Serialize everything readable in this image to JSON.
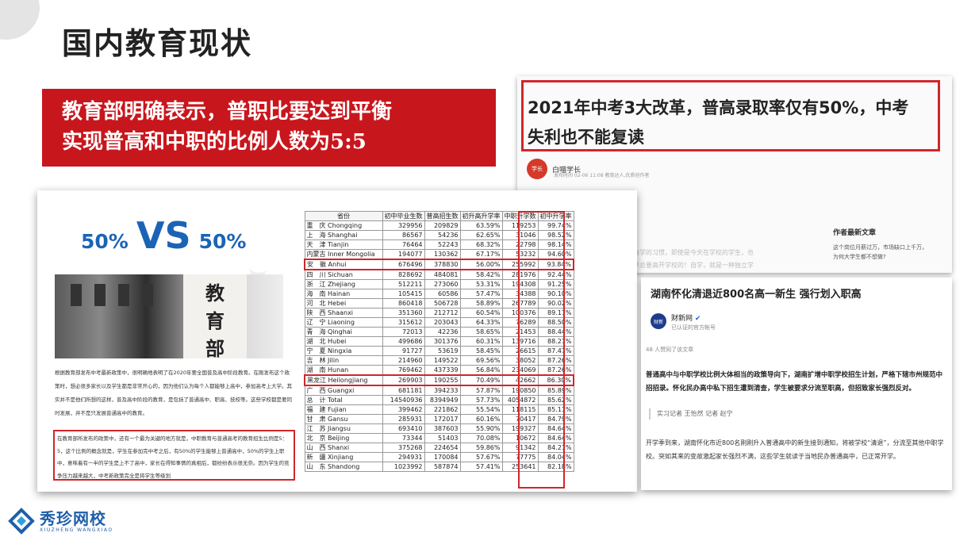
{
  "slide": {
    "title": "国内教育现状",
    "banner_line1": "教育部明确表示，普职比要达到平衡",
    "banner_line2": "实现普高和中职的比例人数为5:5",
    "accent_color": "#c8161d"
  },
  "article1": {
    "headline_line1": "2021年中考3大改革，普高录取率仅有50%，中考",
    "headline_line2": "失利也不能复读",
    "author": "白喵学长",
    "meta": "发布时间 02-06 11:08  教育达人,优质创作者",
    "body_line1": "成自学的习惯，即使是今天在学校的学生，也",
    "body_line2": "是早总要高开学校的！自学，就是一种独立学",
    "side_title": "作者最新文章",
    "side_text": "这个岗位月薪过万，市场缺口上千万，为何大学生都不想做?"
  },
  "article2": {
    "title": "湖南怀化清退近800名高一新生 强行划入职高",
    "source": "财新网",
    "verified": "已认证的官方帐号",
    "likes": "48 人赞同了该文章",
    "lead": "普通高中与中职学校比例大体相当的政策导向下，湖南扩增中职学校招生计划，严格下辖市州规范中招招录。怀化民办高中私下招生遭到清查，学生被要求分流至职高，但招致家长强烈反对。",
    "reporter": "实习记者 王怡然 记者 赵宁",
    "body": "开学季到来，湖南怀化市近800名刚刚升入普通高中的新生接到通知，将被学校“清退”，分流至其他中职学校。突如其来的变故激起家长强烈不满，这些学生就读于当地民办普通高中，已正常开学。"
  },
  "doc": {
    "vs_left": "50%",
    "vs_word": "VS",
    "vs_right": "50%",
    "plaque": [
      "教",
      "育",
      "部"
    ],
    "para1": "根据教育部发布中考最新政策中，很明确地表明了在2020年要全国普及高中阶段教育。在刚发布这个政策时，想必很多家长以及学生都是非常开心的，因为他们认为每个人都能够上高中，参加高考上大学。其实并不是他们所想的这样，普及高中阶段的教育，是包括了普通高中、职高、技校等。这些学校都是要同时发展，并不是只发展普通高中的教育。",
    "para2": "在教育部所发布的政策中，还有一个最为关键的地方就是，中职教育与普通高考的教育招生比例是5：5，这个比例的概念就是，学生在参加完中考之后，有50%的学生能够上普通高中，50%的学生上职中，意味着有一半的学生是上不了高中，家长在得知事情的真相后，都纷纷表示很无奈。因为学生的竞争压力越来越大，中考新政策完全是将学生等级划"
  },
  "table": {
    "headers": [
      "省份",
      "初中毕业生数",
      "普高招生数",
      "初升高升学率",
      "中职升学数",
      "初中升学率"
    ],
    "rows": [
      [
        "重　庆 Chongqing",
        "329956",
        "209829",
        "63.59%",
        "119253",
        "99.74%"
      ],
      [
        "上　海 Shanghai",
        "86567",
        "54236",
        "62.65%",
        "31046",
        "98.52%"
      ],
      [
        "天　津 Tianjin",
        "76464",
        "52243",
        "68.32%",
        "22798",
        "98.14%"
      ],
      [
        "内蒙古 Inner Mongolia",
        "194077",
        "130362",
        "67.17%",
        "53232",
        "94.60%"
      ],
      [
        "安　徽 Anhui",
        "676496",
        "378830",
        "56.00%",
        "255992",
        "93.84%"
      ],
      [
        "四　川 Sichuan",
        "828692",
        "484081",
        "58.42%",
        "281976",
        "92.44%"
      ],
      [
        "浙　江 Zhejiang",
        "512211",
        "273060",
        "53.31%",
        "194308",
        "91.25%"
      ],
      [
        "海　南 Hainan",
        "105415",
        "60586",
        "57.47%",
        "34388",
        "90.10%"
      ],
      [
        "河　北 Hebei",
        "860418",
        "506728",
        "58.89%",
        "267789",
        "90.02%"
      ],
      [
        "陕　西 Shaanxi",
        "351360",
        "212712",
        "60.54%",
        "100376",
        "89.11%"
      ],
      [
        "辽　宁 Liaoning",
        "315612",
        "203043",
        "64.33%",
        "76289",
        "88.50%"
      ],
      [
        "青　海 Qinghai",
        "72013",
        "42236",
        "58.65%",
        "21453",
        "88.44%"
      ],
      [
        "湖　北 Hubei",
        "499686",
        "301376",
        "60.31%",
        "139716",
        "88.27%"
      ],
      [
        "宁　夏 Ningxia",
        "91727",
        "53619",
        "58.45%",
        "26615",
        "87.47%"
      ],
      [
        "吉　林 Jilin",
        "214960",
        "149522",
        "69.56%",
        "38052",
        "87.26%"
      ],
      [
        "湖　南 Hunan",
        "769462",
        "437339",
        "56.84%",
        "234069",
        "87.26%"
      ],
      [
        "黑龙江 Heilongjiang",
        "269903",
        "190255",
        "70.49%",
        "42662",
        "86.30%"
      ],
      [
        "广　西 Guangxi",
        "681181",
        "394233",
        "57.87%",
        "190850",
        "85.89%"
      ],
      [
        "总　计 Total",
        "14540936",
        "8394949",
        "57.73%",
        "4054872",
        "85.62%"
      ],
      [
        "福　建 Fujian",
        "399462",
        "221862",
        "55.54%",
        "118115",
        "85.11%"
      ],
      [
        "甘　肃 Gansu",
        "285931",
        "172017",
        "60.16%",
        "70417",
        "84.79%"
      ],
      [
        "江　苏 Jiangsu",
        "693410",
        "387603",
        "55.90%",
        "199327",
        "84.64%"
      ],
      [
        "北　京 Beijing",
        "73344",
        "51403",
        "70.08%",
        "10672",
        "84.64%"
      ],
      [
        "山　西 Shanxi",
        "375268",
        "224654",
        "59.86%",
        "91342",
        "84.21%"
      ],
      [
        "新　疆 Xinjiang",
        "294931",
        "170084",
        "57.67%",
        "77775",
        "84.04%"
      ],
      [
        "山　东 Shandong",
        "1023992",
        "587874",
        "57.41%",
        "253641",
        "82.18%"
      ]
    ],
    "highlighted_rows": [
      4,
      16
    ]
  },
  "logo": {
    "name": "秀珍网校",
    "sub": "XIUZHENG WANGXIAO",
    "color": "#1f5fa8"
  }
}
